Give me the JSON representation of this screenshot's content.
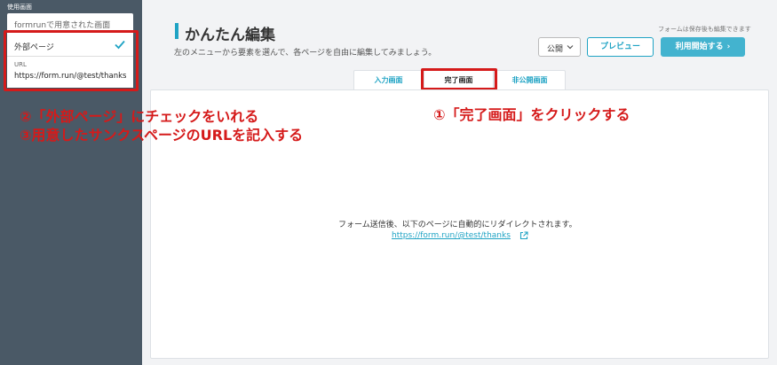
{
  "sidebar": {
    "section_label": "使用画面",
    "select_value": "formrunで用意された画面",
    "dropdown": {
      "external_page_label": "外部ページ",
      "url_label": "URL",
      "url_value": "https://form.run/@test/thanks"
    }
  },
  "header": {
    "title": "かんたん編集",
    "subtitle": "左のメニューから要素を選んで、各ページを自由に編集してみましょう。",
    "save_note": "フォームは保存後も編集できます",
    "publish_select": "公開",
    "preview_button": "プレビュー",
    "start_button": "利用開始する"
  },
  "tabs": [
    {
      "label": "入力画面"
    },
    {
      "label": "完了画面"
    },
    {
      "label": "非公開画面"
    }
  ],
  "main": {
    "redirect_message": "フォーム送信後、以下のページに自動的にリダイレクトされます。",
    "redirect_url": "https://form.run/@test/thanks"
  },
  "annotations": {
    "step1": "①「完了画面」をクリックする",
    "step2": "②「外部ページ」にチェックをいれる",
    "step3": "③用意したサンクスページのURLを記入する"
  },
  "colors": {
    "accent": "#1fa3c4",
    "sidebar_bg": "#4a5966",
    "annotation_red": "#d51a1a"
  }
}
